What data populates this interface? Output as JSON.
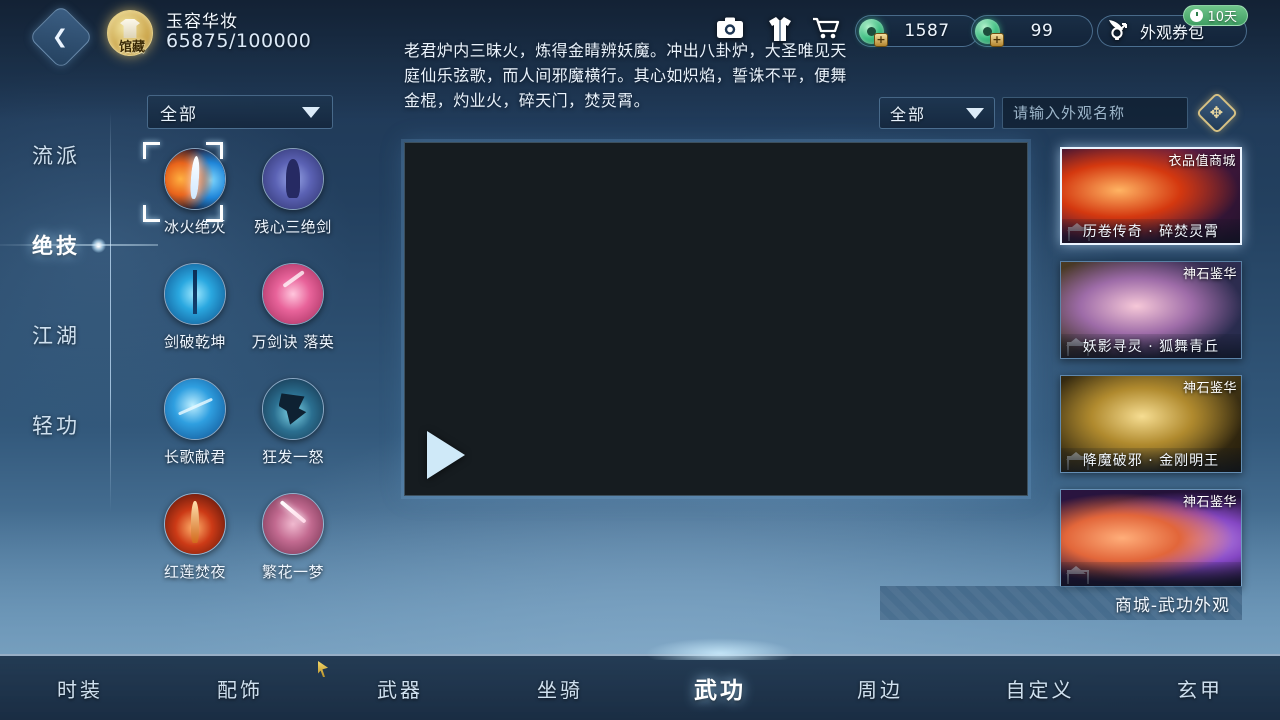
{
  "header": {
    "back_icon": "back-arrow-icon",
    "collection_badge": "馆藏",
    "title": "玉容华妆",
    "progress": "65875/100000",
    "icons": [
      {
        "name": "camera-icon",
        "glyph": "camera"
      },
      {
        "name": "wardrobe-icon",
        "glyph": "wardrobe"
      },
      {
        "name": "cart-icon",
        "glyph": "cart"
      }
    ],
    "currencies": [
      {
        "name": "jade-currency",
        "value": "1587"
      },
      {
        "name": "jade-token-currency",
        "value": "99"
      }
    ],
    "voucher": {
      "label": "外观券包",
      "timer": "10天"
    }
  },
  "description": "老君炉内三昧火，炼得金睛辨妖魔。冲出八卦炉，大圣唯见天庭仙乐弦歌，而人间邪魔横行。其心如炽焰，誓诛不平，便舞金棍，灼业火，碎天门，焚灵霄。",
  "sidebar": {
    "items": [
      {
        "label": "流派",
        "active": false
      },
      {
        "label": "绝技",
        "active": true
      },
      {
        "label": "江湖",
        "active": false
      },
      {
        "label": "轻功",
        "active": false
      }
    ]
  },
  "skill_panel": {
    "filter_label": "全部",
    "skills": [
      {
        "name": "冰火绝灭",
        "art": "a-ice-fire",
        "selected": true
      },
      {
        "name": "残心三绝剑",
        "art": "a-soul",
        "selected": false
      },
      {
        "name": "剑破乾坤",
        "art": "a-sword-blue",
        "selected": false
      },
      {
        "name": "万剑诀 落英",
        "art": "a-pink",
        "selected": false
      },
      {
        "name": "长歌献君",
        "art": "a-song",
        "selected": false
      },
      {
        "name": "狂发一怒",
        "art": "a-fury",
        "selected": false
      },
      {
        "name": "红莲焚夜",
        "art": "a-lotus",
        "selected": false
      },
      {
        "name": "繁花一梦",
        "art": "a-dream",
        "selected": false
      }
    ]
  },
  "preview": {
    "play_label": "play-button"
  },
  "shop": {
    "filter_label": "全部",
    "search_placeholder": "请输入外观名称",
    "search_value": "",
    "banner": "商城-武功外观",
    "cards": [
      {
        "title": "历卷传奇 · 碎焚灵霄",
        "tag": "衣品值商城",
        "art": "c1",
        "active": true
      },
      {
        "title": "妖影寻灵 · 狐舞青丘",
        "tag": "神石鉴华",
        "art": "c2",
        "active": false
      },
      {
        "title": "降魔破邪 · 金刚明王",
        "tag": "神石鉴华",
        "art": "c3",
        "active": false
      },
      {
        "title": "",
        "tag": "神石鉴华",
        "art": "c4",
        "active": false
      }
    ]
  },
  "bottom_nav": {
    "items": [
      {
        "label": "时装",
        "active": false
      },
      {
        "label": "配饰",
        "active": false
      },
      {
        "label": "武器",
        "active": false
      },
      {
        "label": "坐骑",
        "active": false
      },
      {
        "label": "武功",
        "active": true
      },
      {
        "label": "周边",
        "active": false
      },
      {
        "label": "自定义",
        "active": false
      },
      {
        "label": "玄甲",
        "active": false
      }
    ]
  },
  "colors": {
    "accent": "#cfe9f8",
    "gold": "#d6c184",
    "jade": "#3fbf83",
    "timer_green": "#4fa96b"
  }
}
